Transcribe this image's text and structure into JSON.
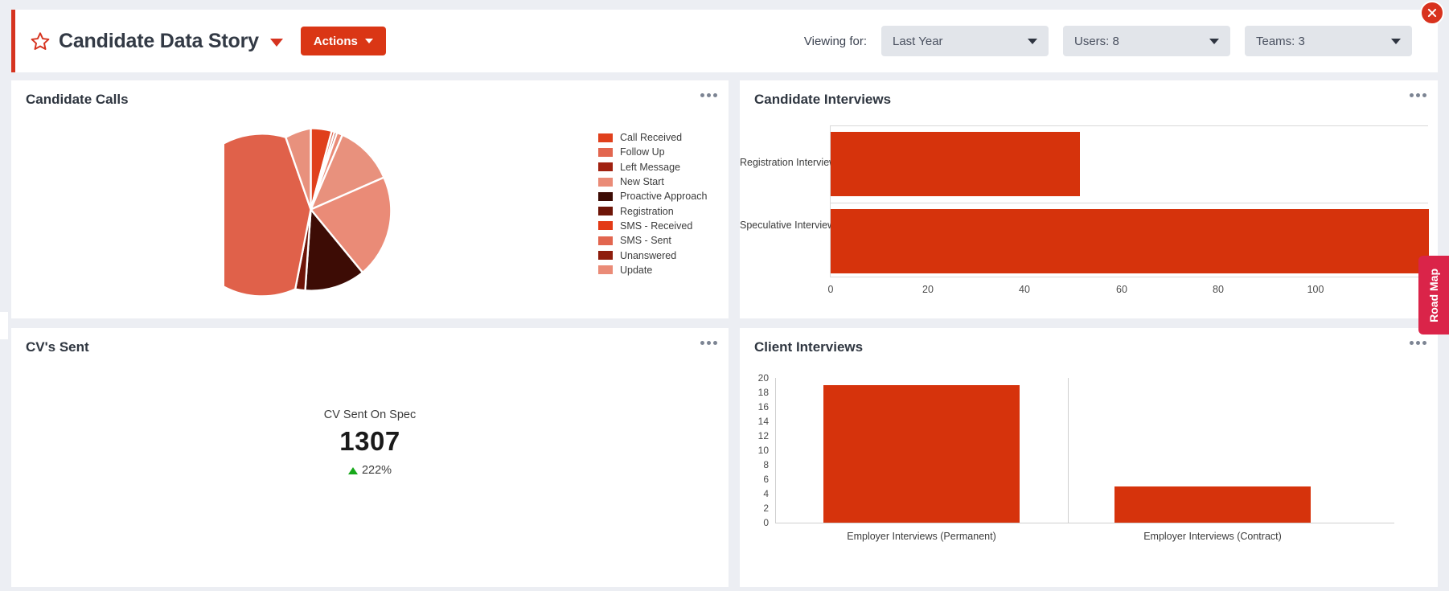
{
  "header": {
    "title": "Candidate Data Story",
    "star_icon": "star-icon",
    "title_caret_icon": "chevron-down-icon",
    "actions_label": "Actions",
    "viewing_label": "Viewing for:",
    "filters": [
      {
        "name": "period",
        "value": "Last Year"
      },
      {
        "name": "users",
        "value": "Users: 8"
      },
      {
        "name": "teams",
        "value": "Teams: 3"
      }
    ],
    "close_icon": "close-icon"
  },
  "side_tab": {
    "label": "Road Map"
  },
  "cards": {
    "candidate_calls": {
      "title": "Candidate Calls",
      "menu_icon": "ellipsis-icon"
    },
    "cvs_sent": {
      "title": "CV's Sent",
      "menu_icon": "ellipsis-icon"
    },
    "candidate_interviews": {
      "title": "Candidate Interviews",
      "menu_icon": "ellipsis-icon"
    },
    "client_interviews": {
      "title": "Client Interviews",
      "menu_icon": "ellipsis-icon"
    }
  },
  "kpi": {
    "label": "CV Sent On Spec",
    "value": "1307",
    "delta": "222%",
    "delta_direction": "up",
    "delta_color": "#17a81a"
  },
  "chart_data": [
    {
      "id": "candidate-calls-pie",
      "type": "pie",
      "title": "Candidate Calls",
      "legend_position": "right",
      "categories": [
        "Call Received",
        "Follow Up",
        "Left Message",
        "New Start",
        "Proactive Approach",
        "Registration",
        "SMS - Received",
        "SMS - Sent",
        "Unanswered",
        "Update"
      ],
      "colors": [
        "#e0401c",
        "#e2664f",
        "#a02110",
        "#ea8b77",
        "#3d0c05",
        "#6e1508",
        "#e33a16",
        "#e2664f",
        "#8e1d0c",
        "#ea8b77"
      ],
      "values": [
        4.2,
        0.6,
        0.5,
        1.1,
        15.5,
        0.3,
        1.6,
        30.0,
        1.6,
        8.5
      ],
      "note": "slice sizes expressed as percent of total"
    },
    {
      "id": "candidate-interviews-bar",
      "type": "bar",
      "orientation": "horizontal",
      "title": "Candidate Interviews",
      "categories": [
        "Registration Interview",
        "Speculative Interview"
      ],
      "values": [
        50,
        118
      ],
      "xlabel": "",
      "ylabel": "",
      "xlim": [
        0,
        120
      ],
      "xticks": [
        0,
        20,
        40,
        60,
        80,
        100
      ],
      "bar_color": "#d6330c",
      "grid": true
    },
    {
      "id": "client-interviews-bar",
      "type": "bar",
      "orientation": "vertical",
      "title": "Client Interviews",
      "categories": [
        "Employer Interviews (Permanent)",
        "Employer Interviews (Contract)"
      ],
      "values": [
        19,
        5
      ],
      "xlabel": "",
      "ylabel": "",
      "ylim": [
        0,
        20
      ],
      "yticks": [
        20,
        18,
        16,
        14,
        12,
        10,
        8,
        6,
        4,
        2,
        0
      ],
      "bar_color": "#d6330c",
      "grid": false
    }
  ],
  "theme": {
    "accent": "#d6331f",
    "action_button": "#da3615",
    "bar": "#d6330c",
    "page_bg": "#eceef3",
    "card_bg": "#ffffff",
    "roadmap_tab": "#da2449"
  }
}
